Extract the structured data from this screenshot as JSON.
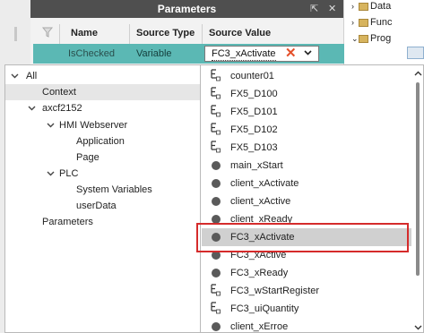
{
  "parameters_panel": {
    "title": "Parameters",
    "pin_glyph": "⇱",
    "close_glyph": "✕",
    "columns": [
      "Name",
      "Source Type",
      "Source Value"
    ],
    "row": {
      "name": "IsChecked",
      "source_type": "Variable",
      "source_value": "FC3_xActivate"
    },
    "accent_color": "#5bb8b4",
    "clear_glyph": "✕",
    "chevron_glyph": "⌄"
  },
  "background_tree": {
    "items": [
      {
        "label": "Data"
      },
      {
        "label": "Func"
      },
      {
        "label": "Prog"
      }
    ]
  },
  "tree": {
    "items": [
      {
        "label": "All",
        "expanded": true
      },
      {
        "label": "Context",
        "selected": true
      },
      {
        "label": "axcf2152",
        "expanded": true
      },
      {
        "label": "HMI Webserver",
        "expanded": true
      },
      {
        "label": "Application"
      },
      {
        "label": "Page"
      },
      {
        "label": "PLC",
        "expanded": true
      },
      {
        "label": "System Variables"
      },
      {
        "label": "userData"
      },
      {
        "label": "Parameters"
      }
    ]
  },
  "variable_list": {
    "items": [
      {
        "label": "counter01",
        "icon": "variable-e-icon"
      },
      {
        "label": "FX5_D100",
        "icon": "variable-e-icon"
      },
      {
        "label": "FX5_D101",
        "icon": "variable-e-icon"
      },
      {
        "label": "FX5_D102",
        "icon": "variable-e-icon"
      },
      {
        "label": "FX5_D103",
        "icon": "variable-e-icon"
      },
      {
        "label": "main_xStart",
        "icon": "boolean-dot-icon"
      },
      {
        "label": "client_xActivate",
        "icon": "boolean-dot-icon"
      },
      {
        "label": "client_xActive",
        "icon": "boolean-dot-icon"
      },
      {
        "label": "client_xReady",
        "icon": "boolean-dot-icon"
      },
      {
        "label": "FC3_xActivate",
        "icon": "boolean-dot-icon",
        "selected": true
      },
      {
        "label": "FC3_xActive",
        "icon": "boolean-dot-icon"
      },
      {
        "label": "FC3_xReady",
        "icon": "boolean-dot-icon"
      },
      {
        "label": "FC3_wStartRegister",
        "icon": "variable-e-icon"
      },
      {
        "label": "FC3_uiQuantity",
        "icon": "variable-e-icon"
      },
      {
        "label": "client_xErroe",
        "icon": "boolean-dot-icon"
      }
    ],
    "highlight_color": "#d52b2b"
  }
}
